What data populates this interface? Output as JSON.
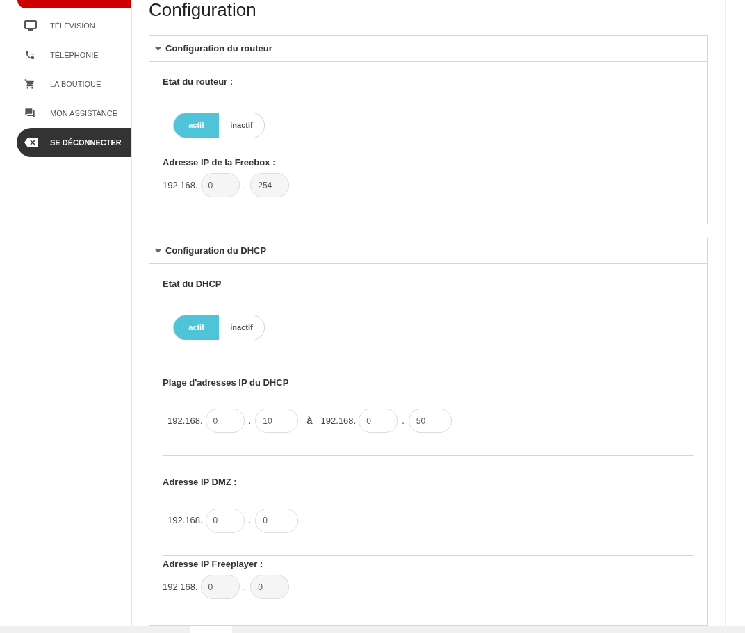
{
  "sidebar": {
    "items": [
      {
        "kind": "tv",
        "label": "TÉLÉVISION",
        "selected": false
      },
      {
        "kind": "phone",
        "label": "TÉLÉPHONIE",
        "selected": false
      },
      {
        "kind": "cart",
        "label": "LA BOUTIQUE",
        "selected": false
      },
      {
        "kind": "chat",
        "label": "MON ASSISTANCE",
        "selected": false
      },
      {
        "kind": "logout",
        "label": "SE DÉCONNECTER",
        "selected": true
      }
    ]
  },
  "title": "Configuration",
  "panels": [
    {
      "title": "Configuration du routeur",
      "expanded": true,
      "groups": [
        {
          "kind": "toggle",
          "label": "Etat du routeur :",
          "options": [
            {
              "label": "actif",
              "selected": true
            },
            {
              "label": "inactif",
              "selected": false
            }
          ]
        },
        {
          "kind": "ipinline",
          "label": "Adresse IP de la Freebox :",
          "ranges": [
            {
              "prefix": "192.168.",
              "dot": ".",
              "octets": [
                {
                  "value": "0",
                  "disabled": true
                },
                {
                  "value": "254",
                  "disabled": true
                }
              ]
            }
          ]
        }
      ]
    },
    {
      "title": "Configuration du DHCP",
      "expanded": true,
      "groups": [
        {
          "kind": "toggle",
          "label": "Etat du DHCP",
          "options": [
            {
              "label": "actif",
              "selected": true
            },
            {
              "label": "inactif",
              "selected": false
            }
          ]
        },
        {
          "kind": "ip",
          "label": "Plage d'adresses IP du DHCP",
          "separator": "à",
          "ranges": [
            {
              "prefix": "192.168.",
              "dot": ".",
              "octets": [
                {
                  "value": "0",
                  "disabled": false
                },
                {
                  "value": "10",
                  "disabled": false
                }
              ]
            },
            {
              "prefix": "192.168.",
              "dot": ".",
              "octets": [
                {
                  "value": "0",
                  "disabled": false
                },
                {
                  "value": "50",
                  "disabled": false
                }
              ]
            }
          ]
        },
        {
          "kind": "ip",
          "label": "Adresse IP DMZ :",
          "ranges": [
            {
              "prefix": "192.168.",
              "dot": ".",
              "octets": [
                {
                  "value": "0",
                  "disabled": false
                },
                {
                  "value": "0",
                  "disabled": false
                }
              ]
            }
          ]
        },
        {
          "kind": "ipinline",
          "label": "Adresse IP Freeplayer :",
          "ranges": [
            {
              "prefix": "192.168.",
              "dot": ".",
              "octets": [
                {
                  "value": "0",
                  "disabled": true
                },
                {
                  "value": "0",
                  "disabled": true
                }
              ]
            }
          ]
        }
      ]
    }
  ]
}
